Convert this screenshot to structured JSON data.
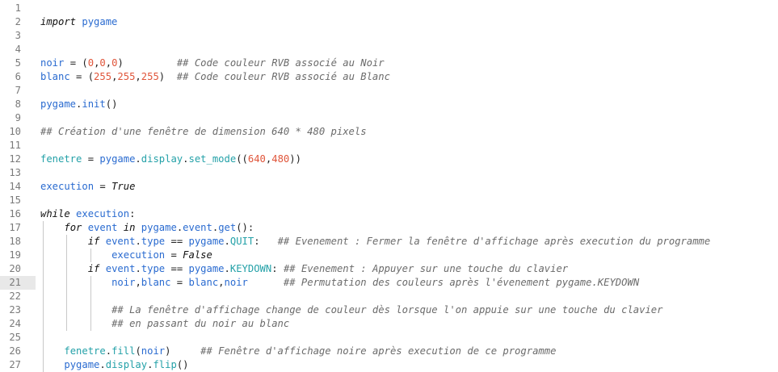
{
  "editor": {
    "current_line": 21,
    "lines": [
      {
        "n": "1",
        "indent": 0,
        "tokens": []
      },
      {
        "n": "2",
        "indent": 0,
        "tokens": [
          {
            "t": "import",
            "c": "kw"
          },
          {
            "t": " ",
            "c": "op"
          },
          {
            "t": "pygame",
            "c": "id"
          }
        ]
      },
      {
        "n": "3",
        "indent": 0,
        "tokens": []
      },
      {
        "n": "4",
        "indent": 0,
        "tokens": []
      },
      {
        "n": "5",
        "indent": 0,
        "tokens": [
          {
            "t": "noir",
            "c": "id"
          },
          {
            "t": " = (",
            "c": "op"
          },
          {
            "t": "0",
            "c": "num"
          },
          {
            "t": ",",
            "c": "op"
          },
          {
            "t": "0",
            "c": "num"
          },
          {
            "t": ",",
            "c": "op"
          },
          {
            "t": "0",
            "c": "num"
          },
          {
            "t": ")         ",
            "c": "op"
          },
          {
            "t": "## Code couleur RVB associé au Noir",
            "c": "cm"
          }
        ]
      },
      {
        "n": "6",
        "indent": 0,
        "tokens": [
          {
            "t": "blanc",
            "c": "id"
          },
          {
            "t": " = (",
            "c": "op"
          },
          {
            "t": "255",
            "c": "num"
          },
          {
            "t": ",",
            "c": "op"
          },
          {
            "t": "255",
            "c": "num"
          },
          {
            "t": ",",
            "c": "op"
          },
          {
            "t": "255",
            "c": "num"
          },
          {
            "t": ")  ",
            "c": "op"
          },
          {
            "t": "## Code couleur RVB associé au Blanc",
            "c": "cm"
          }
        ]
      },
      {
        "n": "7",
        "indent": 0,
        "tokens": []
      },
      {
        "n": "8",
        "indent": 0,
        "tokens": [
          {
            "t": "pygame",
            "c": "id"
          },
          {
            "t": ".",
            "c": "op"
          },
          {
            "t": "init",
            "c": "id"
          },
          {
            "t": "()",
            "c": "op"
          }
        ]
      },
      {
        "n": "9",
        "indent": 0,
        "tokens": []
      },
      {
        "n": "10",
        "indent": 0,
        "tokens": [
          {
            "t": "## Création d'une fenêtre de dimension 640 * 480 pixels",
            "c": "cm"
          }
        ]
      },
      {
        "n": "11",
        "indent": 0,
        "tokens": []
      },
      {
        "n": "12",
        "indent": 0,
        "tokens": [
          {
            "t": "fenetre",
            "c": "fn"
          },
          {
            "t": " = ",
            "c": "op"
          },
          {
            "t": "pygame",
            "c": "id"
          },
          {
            "t": ".",
            "c": "op"
          },
          {
            "t": "display",
            "c": "fn"
          },
          {
            "t": ".",
            "c": "op"
          },
          {
            "t": "set_mode",
            "c": "fn"
          },
          {
            "t": "((",
            "c": "op"
          },
          {
            "t": "640",
            "c": "num"
          },
          {
            "t": ",",
            "c": "op"
          },
          {
            "t": "480",
            "c": "num"
          },
          {
            "t": "))",
            "c": "op"
          }
        ]
      },
      {
        "n": "13",
        "indent": 0,
        "tokens": []
      },
      {
        "n": "14",
        "indent": 0,
        "tokens": [
          {
            "t": "execution",
            "c": "id"
          },
          {
            "t": " = ",
            "c": "op"
          },
          {
            "t": "True",
            "c": "kw"
          }
        ]
      },
      {
        "n": "15",
        "indent": 0,
        "tokens": []
      },
      {
        "n": "16",
        "indent": 0,
        "tokens": [
          {
            "t": "while",
            "c": "kw"
          },
          {
            "t": " ",
            "c": "op"
          },
          {
            "t": "execution",
            "c": "id"
          },
          {
            "t": ":",
            "c": "op"
          }
        ]
      },
      {
        "n": "17",
        "indent": 1,
        "tokens": [
          {
            "t": "for",
            "c": "kw"
          },
          {
            "t": " ",
            "c": "op"
          },
          {
            "t": "event",
            "c": "id"
          },
          {
            "t": " ",
            "c": "op"
          },
          {
            "t": "in",
            "c": "kw"
          },
          {
            "t": " ",
            "c": "op"
          },
          {
            "t": "pygame",
            "c": "id"
          },
          {
            "t": ".",
            "c": "op"
          },
          {
            "t": "event",
            "c": "id"
          },
          {
            "t": ".",
            "c": "op"
          },
          {
            "t": "get",
            "c": "id"
          },
          {
            "t": "():",
            "c": "op"
          }
        ]
      },
      {
        "n": "18",
        "indent": 2,
        "tokens": [
          {
            "t": "if",
            "c": "kw"
          },
          {
            "t": " ",
            "c": "op"
          },
          {
            "t": "event",
            "c": "id"
          },
          {
            "t": ".",
            "c": "op"
          },
          {
            "t": "type",
            "c": "id"
          },
          {
            "t": " == ",
            "c": "op"
          },
          {
            "t": "pygame",
            "c": "id"
          },
          {
            "t": ".",
            "c": "op"
          },
          {
            "t": "QUIT",
            "c": "fn"
          },
          {
            "t": ":   ",
            "c": "op"
          },
          {
            "t": "## Evenement : Fermer la fenêtre d'affichage après execution du programme",
            "c": "cm"
          }
        ]
      },
      {
        "n": "19",
        "indent": 3,
        "tokens": [
          {
            "t": "execution",
            "c": "id"
          },
          {
            "t": " = ",
            "c": "op"
          },
          {
            "t": "False",
            "c": "kw"
          }
        ]
      },
      {
        "n": "20",
        "indent": 2,
        "tokens": [
          {
            "t": "if",
            "c": "kw"
          },
          {
            "t": " ",
            "c": "op"
          },
          {
            "t": "event",
            "c": "id"
          },
          {
            "t": ".",
            "c": "op"
          },
          {
            "t": "type",
            "c": "id"
          },
          {
            "t": " == ",
            "c": "op"
          },
          {
            "t": "pygame",
            "c": "id"
          },
          {
            "t": ".",
            "c": "op"
          },
          {
            "t": "KEYDOWN",
            "c": "fn"
          },
          {
            "t": ": ",
            "c": "op"
          },
          {
            "t": "## Evenement : Appuyer sur une touche du clavier",
            "c": "cm"
          }
        ]
      },
      {
        "n": "21",
        "indent": 3,
        "tokens": [
          {
            "t": "noir",
            "c": "id"
          },
          {
            "t": ",",
            "c": "op"
          },
          {
            "t": "blanc",
            "c": "id"
          },
          {
            "t": " = ",
            "c": "op"
          },
          {
            "t": "blanc",
            "c": "id"
          },
          {
            "t": ",",
            "c": "op"
          },
          {
            "t": "noir",
            "c": "id"
          },
          {
            "t": "      ",
            "c": "op"
          },
          {
            "t": "## Permutation des couleurs après l'évenement pygame.KEYDOWN",
            "c": "cm"
          }
        ]
      },
      {
        "n": "22",
        "indent": 3,
        "tokens": []
      },
      {
        "n": "23",
        "indent": 3,
        "tokens": [
          {
            "t": "## La fenêtre d'affichage change de couleur dès lorsque l'on appuie sur une touche du clavier",
            "c": "cm"
          }
        ]
      },
      {
        "n": "24",
        "indent": 3,
        "tokens": [
          {
            "t": "## en passant du noir au blanc",
            "c": "cm"
          }
        ]
      },
      {
        "n": "25",
        "indent": 0,
        "tokens": []
      },
      {
        "n": "26",
        "indent": 1,
        "tokens": [
          {
            "t": "fenetre",
            "c": "fn"
          },
          {
            "t": ".",
            "c": "op"
          },
          {
            "t": "fill",
            "c": "fn"
          },
          {
            "t": "(",
            "c": "op"
          },
          {
            "t": "noir",
            "c": "id"
          },
          {
            "t": ")     ",
            "c": "op"
          },
          {
            "t": "## Fenêtre d'affichage noire après execution de ce programme",
            "c": "cm"
          }
        ]
      },
      {
        "n": "27",
        "indent": 1,
        "tokens": [
          {
            "t": "pygame",
            "c": "id"
          },
          {
            "t": ".",
            "c": "op"
          },
          {
            "t": "display",
            "c": "fn"
          },
          {
            "t": ".",
            "c": "op"
          },
          {
            "t": "flip",
            "c": "fn"
          },
          {
            "t": "()",
            "c": "op"
          }
        ]
      }
    ]
  }
}
